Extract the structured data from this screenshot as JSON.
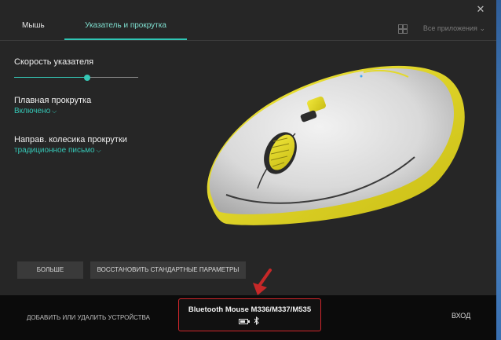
{
  "window": {
    "close_glyph": "✕"
  },
  "tabs": [
    {
      "label": "Мышь"
    },
    {
      "label": "Указатель и прокрутка",
      "active": true
    }
  ],
  "apps_selector": {
    "label": "Все приложения",
    "chevron": "⌄",
    "icon": "grid-icon"
  },
  "settings": {
    "pointer_speed": {
      "label": "Скорость указателя",
      "level_fraction": 0.59
    },
    "smooth_scroll": {
      "label": "Плавная прокрутка",
      "value": "Включено"
    },
    "scroll_direction": {
      "label": "Направ. колесика прокрутки",
      "value": "традиционное письмо"
    }
  },
  "buttons": {
    "more": "БОЛЬШЕ",
    "reset": "ВОССТАНОВИТЬ СТАНДАРТНЫЕ ПАРАМЕТРЫ"
  },
  "bottom": {
    "add_device": "ДОБАВИТЬ ИЛИ УДАЛИТЬ УСТРОЙСТВА",
    "device_name": "Bluetooth Mouse M336/M337/M535",
    "battery_level": 0.75,
    "login": "ВХОД"
  },
  "colors": {
    "accent": "#35c7b6",
    "highlight_border": "#d1262b",
    "arrow": "#c62828",
    "mouse_accent": "#e3d92a"
  }
}
